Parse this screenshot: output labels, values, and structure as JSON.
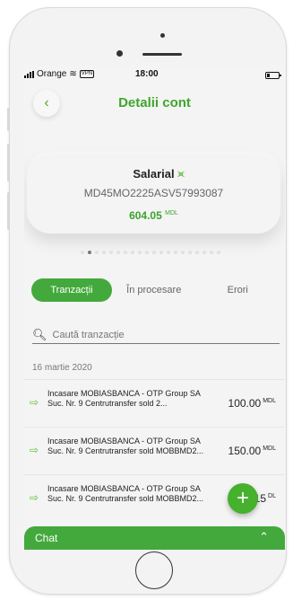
{
  "status_bar": {
    "carrier": "Orange",
    "vpn": "VPN",
    "time": "18:00"
  },
  "header": {
    "title": "Detalii cont"
  },
  "account": {
    "name": "Salarial",
    "iban": "MD45MO2225ASV57993087",
    "balance_amount": "604.05",
    "currency": "MDL"
  },
  "tabs": [
    {
      "label": "Tranzacții",
      "active": true
    },
    {
      "label": "În procesare",
      "active": false
    },
    {
      "label": "Erori",
      "active": false
    }
  ],
  "search": {
    "placeholder": "Caută tranzacție"
  },
  "date_group": "16 martie 2020",
  "transactions": [
    {
      "line1": "Incasare MOBIASBANCA - OTP Group SA",
      "line2": "Suc. Nr. 9 Centrutransfer sold 2...",
      "amount": "100.00",
      "currency": "MDL"
    },
    {
      "line1": "Incasare MOBIASBANCA - OTP Group SA",
      "line2": "Suc. Nr. 9 Centrutransfer sold MOBBMD2...",
      "amount": "150.00",
      "currency": "MDL"
    },
    {
      "line1": "Incasare MOBIASBANCA - OTP Group SA",
      "line2": "Suc. Nr. 9 Centrutransfer sold MOBBMD2...",
      "amount": "15",
      "currency": "DL"
    }
  ],
  "chat": {
    "label": "Chat"
  },
  "colors": {
    "accent": "#43a93c",
    "accent_text": "#3fa62b"
  }
}
